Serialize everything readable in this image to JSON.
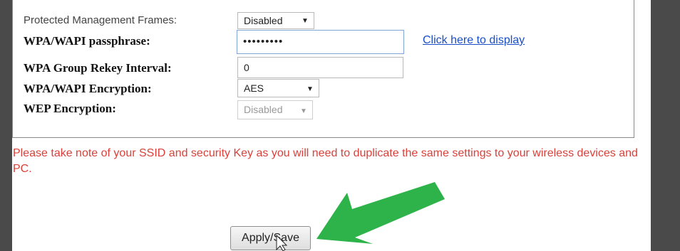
{
  "form": {
    "pmf": {
      "label": "Protected Management Frames:",
      "value": "Disabled"
    },
    "passphrase": {
      "label": "WPA/WAPI passphrase:",
      "value": "•••••••••"
    },
    "display_link": "Click here to display",
    "rekey": {
      "label": "WPA Group Rekey Interval:",
      "value": "0"
    },
    "encryption": {
      "label": "WPA/WAPI Encryption:",
      "value": "AES"
    },
    "wep": {
      "label": "WEP Encryption:",
      "value": "Disabled"
    }
  },
  "note": "Please take note of your SSID and security Key as you will need to duplicate the same settings to your wireless devices and PC.",
  "apply_button": "Apply/Save",
  "colors": {
    "note_text": "#d9413a",
    "link": "#1b4fc8",
    "annotation_arrow": "#2db34a",
    "side_bars": "#4a4a4a"
  },
  "icons": {
    "dropdown": "triangle-down",
    "annotation": "green-arrow",
    "cursor": "mouse-pointer"
  }
}
